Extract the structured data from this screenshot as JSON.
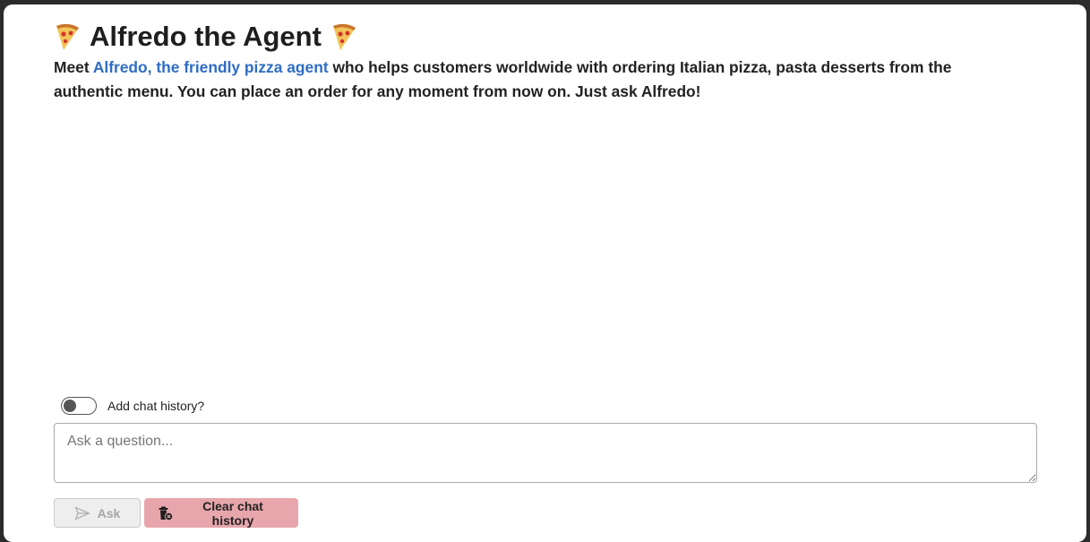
{
  "header": {
    "title": "Alfredo the Agent",
    "left_icon": "pizza-icon",
    "right_icon": "pizza-icon"
  },
  "intro": {
    "prefix": "Meet ",
    "link_text": "Alfredo, the friendly pizza agent",
    "suffix": " who helps customers worldwide with ordering Italian pizza, pasta desserts from the authentic menu. You can place an order for any moment from now on. Just ask Alfredo!"
  },
  "chat_history_toggle": {
    "label": "Add chat history?",
    "checked": false
  },
  "question": {
    "placeholder": "Ask a question...",
    "value": ""
  },
  "actions": {
    "ask_label": "Ask",
    "ask_icon": "send-icon",
    "ask_disabled": true,
    "clear_label": "Clear chat history",
    "clear_icon": "trash-icon"
  },
  "colors": {
    "link": "#2f6dc4",
    "clear_button_bg": "#e7a6ab",
    "ask_button_bg": "#eeeeee"
  }
}
